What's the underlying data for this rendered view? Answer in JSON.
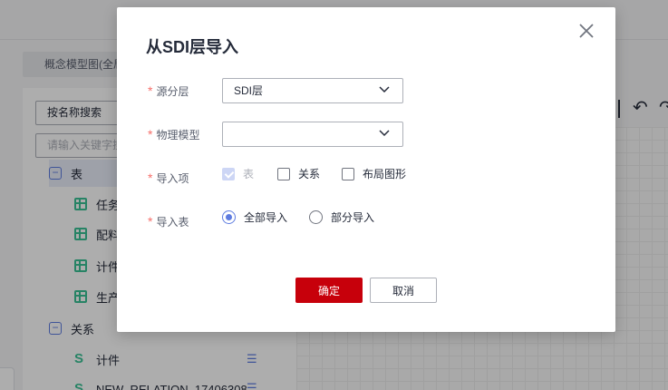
{
  "background": {
    "tab_label": "概念模型图(全局",
    "search_mode": "按名称搜索",
    "search_placeholder": "请输入关键字搜",
    "tree": {
      "group_table": "表",
      "tables": [
        "任务",
        "配料",
        "计件",
        "生产"
      ],
      "group_relation": "关系",
      "relations": [
        "计件",
        "NEW_RELATION_17406308"
      ]
    }
  },
  "dialog": {
    "title": "从SDI层导入",
    "fields": {
      "source_layer": {
        "label": "源分层",
        "value": "SDI层"
      },
      "physical_model": {
        "label": "物理模型",
        "value": ""
      },
      "import_items": {
        "label": "导入项",
        "options": [
          {
            "label": "表",
            "checked": true,
            "disabled": true
          },
          {
            "label": "关系",
            "checked": false
          },
          {
            "label": "布局图形",
            "checked": false
          }
        ]
      },
      "import_table": {
        "label": "导入表",
        "options": [
          {
            "label": "全部导入",
            "selected": true
          },
          {
            "label": "部分导入",
            "selected": false
          }
        ]
      }
    },
    "required_mark": "*",
    "buttons": {
      "ok": "确定",
      "cancel": "取消"
    }
  },
  "colors": {
    "primary": "#c7000b",
    "accent": "#5e7ce0",
    "tree_icon": "#3ac295"
  }
}
